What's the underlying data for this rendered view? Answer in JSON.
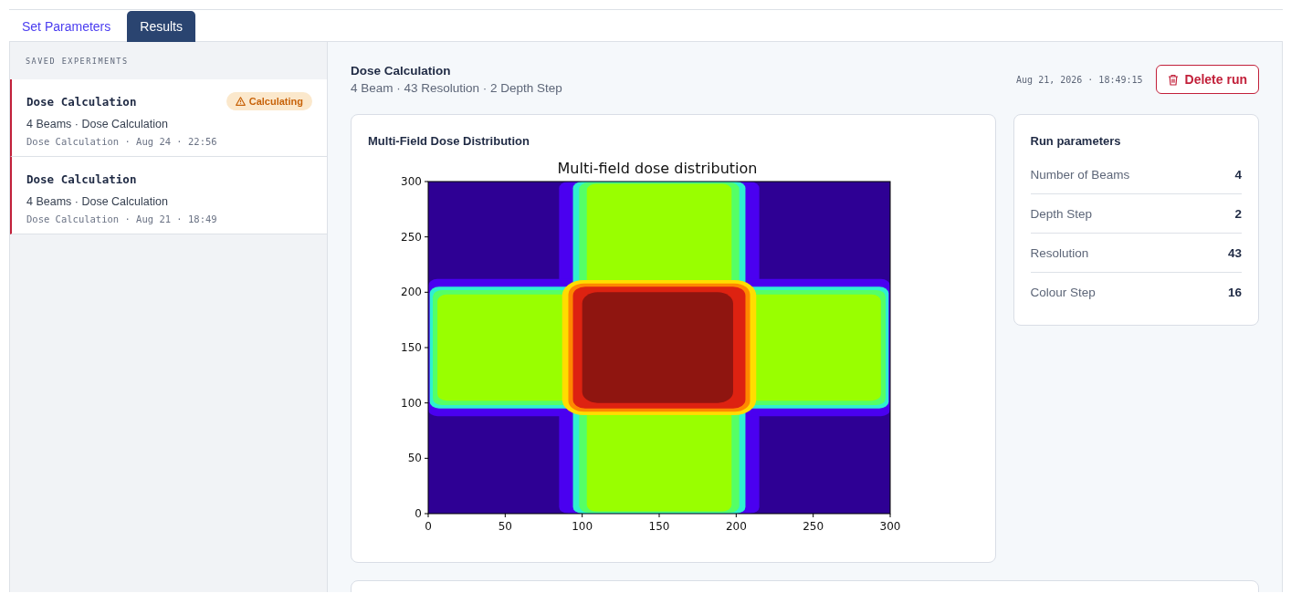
{
  "tabs": [
    {
      "label": "Set Parameters",
      "selected": false
    },
    {
      "label": "Results",
      "selected": true
    }
  ],
  "sidebar": {
    "heading": "SAVED EXPERIMENTS",
    "items": [
      {
        "title": "Dose Calculation",
        "status": {
          "kind": "warning",
          "label": "Calculating"
        },
        "subtitle": "4 Beams · Dose Calculation",
        "meta": "Dose Calculation · Aug 24 · 22:56"
      },
      {
        "title": "Dose Calculation",
        "subtitle": "4 Beams · Dose Calculation",
        "meta": "Dose Calculation · Aug 21 · 18:49"
      }
    ]
  },
  "run": {
    "title": "Dose Calculation",
    "subtitle": "4 Beam · 43 Resolution · 2 Depth Step",
    "timestamp": "Aug 21, 2026 · 18:49:15",
    "delete_button": "Delete run"
  },
  "plot_card": {
    "title": "Multi-Field Dose Distribution",
    "plot": {
      "title": "Multi-field dose distribution",
      "xticks": [
        "0",
        "50",
        "100",
        "150",
        "200",
        "250",
        "300"
      ],
      "yticks": [
        "300",
        "250",
        "200",
        "150",
        "100",
        "50",
        "0"
      ]
    }
  },
  "parameters": {
    "title": "Run parameters",
    "rows": [
      {
        "label": "Number of Beams",
        "value": "4"
      },
      {
        "label": "Depth Step",
        "value": "2"
      },
      {
        "label": "Resolution",
        "value": "43"
      },
      {
        "label": "Colour Step",
        "value": "16"
      }
    ]
  }
}
